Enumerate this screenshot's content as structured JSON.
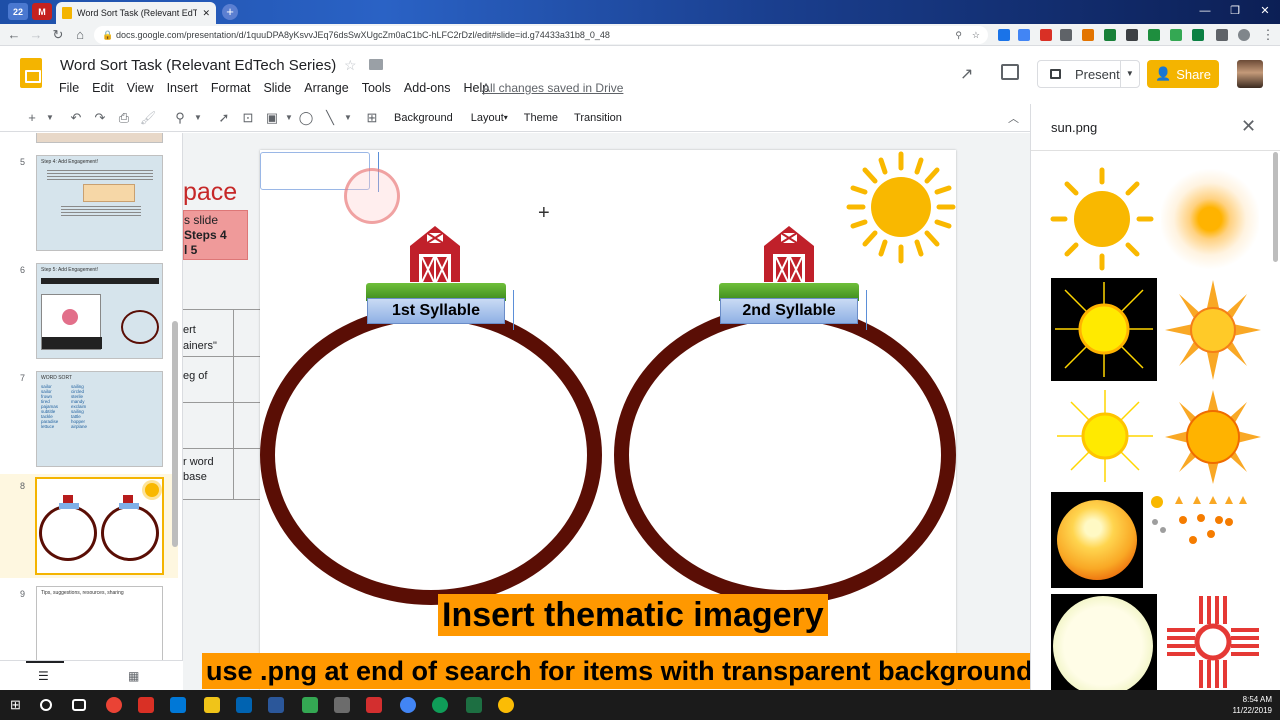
{
  "browser": {
    "tab_title": "Word Sort Task (Relevant EdTech",
    "new_tab_label": "+",
    "url": "docs.google.com/presentation/d/1quuDPA8yKsvvJEq76dsSwXUgcZm0aC1bC-hLFC2rDzl/edit#slide=id.g74433a31b8_0_48",
    "window_controls": [
      "—",
      "❐",
      "✕"
    ]
  },
  "app": {
    "doc_title": "Word Sort Task (Relevant EdTech Series)",
    "menus": [
      "File",
      "Edit",
      "View",
      "Insert",
      "Format",
      "Slide",
      "Arrange",
      "Tools",
      "Add-ons",
      "Help"
    ],
    "save_status": "All changes saved in Drive",
    "present_label": "Present",
    "share_label": "Share"
  },
  "toolbar": {
    "background_label": "Background",
    "layout_label": "Layout",
    "theme_label": "Theme",
    "transition_label": "Transition"
  },
  "filmstrip": {
    "slides": [
      {
        "number": "5",
        "title": "Step 4: Add Engagement!"
      },
      {
        "number": "6",
        "title": "Step 5: Add Engagement!"
      },
      {
        "number": "7",
        "title": "WORD SORT"
      },
      {
        "number": "8",
        "title": ""
      },
      {
        "number": "9",
        "title": "Tips, suggestions, resources, sharing"
      }
    ],
    "slide7_words": [
      "sailor",
      "sailing",
      "sailor",
      "circled",
      "frown",
      "sterile",
      "tired",
      "mandy",
      "pajamas",
      "exclaim",
      "subtitle",
      "sailing",
      "tackle",
      "tattle",
      "paradise",
      "hopper",
      "lettuce",
      "airplane"
    ]
  },
  "canvas": {
    "offslide_left": {
      "heading": "pace",
      "pink_box": [
        "s slide",
        "Steps 4",
        "l 5"
      ],
      "table_cells": [
        "ert",
        "ainers\"",
        "eg of",
        "r word",
        "base"
      ]
    },
    "box1_label": "1st Syllable",
    "box2_label": "2nd Syllable",
    "caption_title": "Insert thematic imagery",
    "caption_subtitle": "use .png at end of search for items with transparent backgrounds"
  },
  "search_panel": {
    "query": "sun.png",
    "results": [
      "sun-result-1",
      "sun-result-2",
      "sun-result-3",
      "sun-result-4",
      "sun-result-5",
      "sun-result-6",
      "sun-result-7",
      "sun-result-8",
      "sun-result-9",
      "sun-result-10"
    ]
  },
  "taskbar": {
    "time": "8:54 AM",
    "date": "11/22/2019"
  },
  "colors": {
    "slides_yellow": "#f4b400",
    "caption_orange": "#ff9800",
    "ring_brown": "#5a0e05"
  }
}
